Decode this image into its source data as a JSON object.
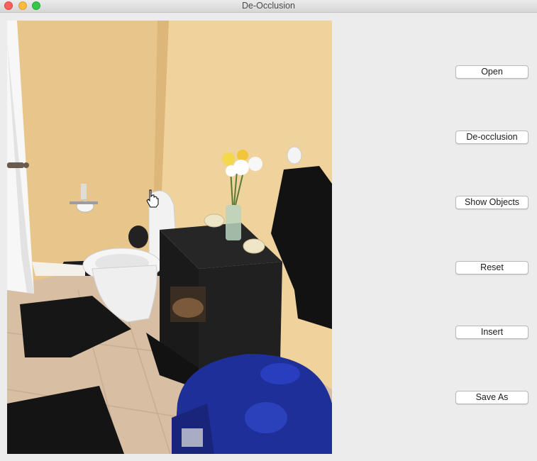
{
  "window": {
    "title": "De-Occlusion"
  },
  "canvas": {
    "photo_icon": "image-icon",
    "cursor_icon": "hand-cursor-icon"
  },
  "buttons": {
    "open": "Open",
    "de_occlusion": "De-occlusion",
    "show_objects": "Show Objects",
    "reset": "Reset",
    "insert": "Insert",
    "save_as": "Save As"
  },
  "colors": {
    "close": "#fc605c",
    "minimize": "#fdbc40",
    "zoom": "#34c84a"
  }
}
